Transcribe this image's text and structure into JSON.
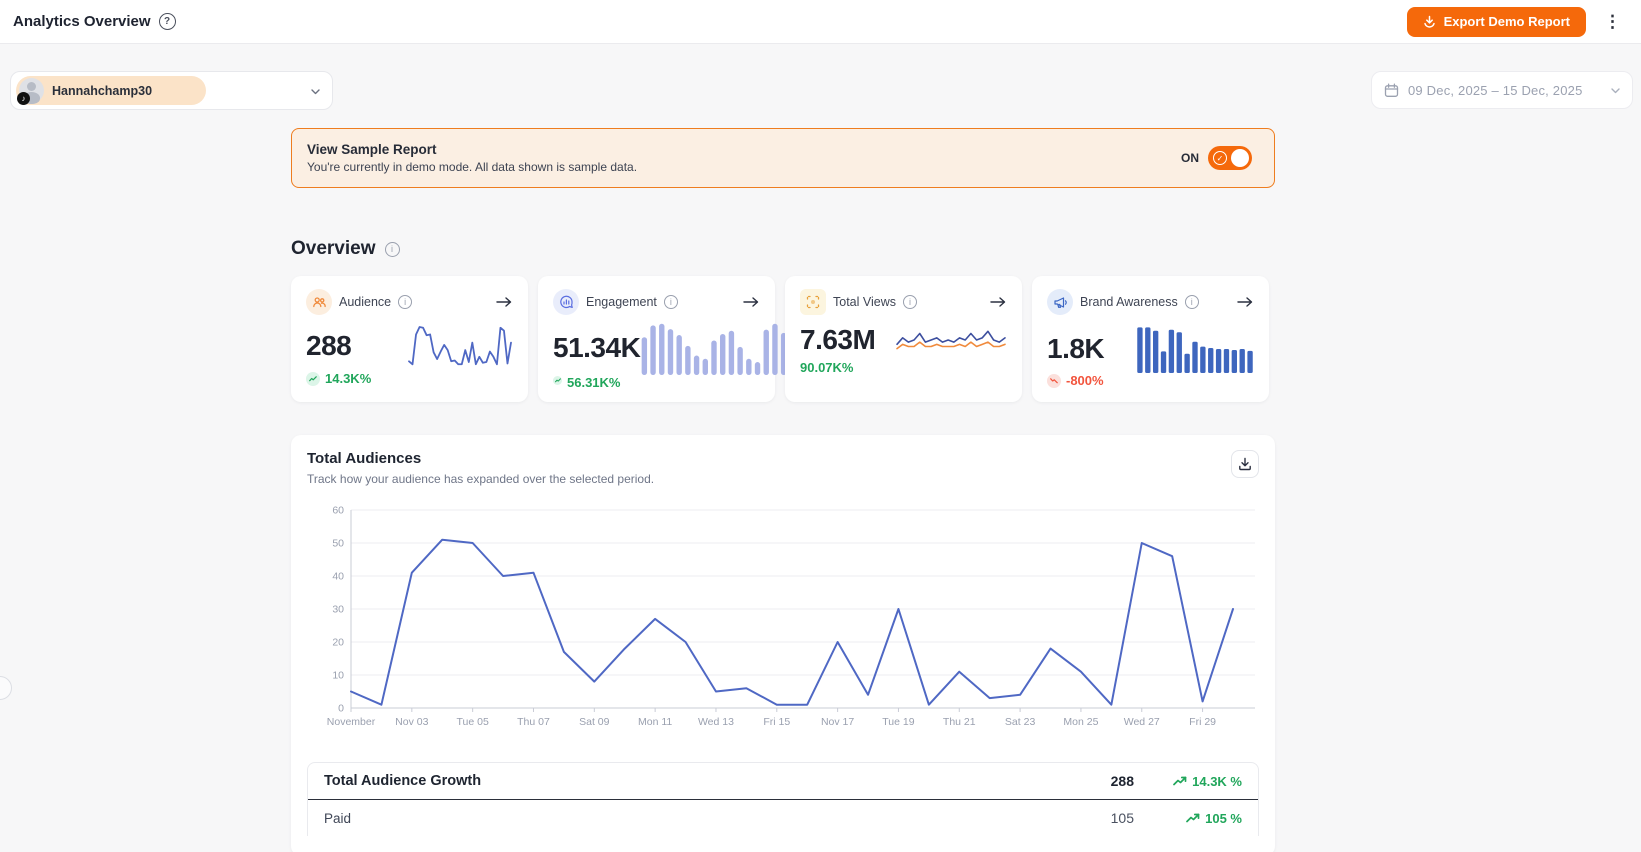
{
  "header": {
    "title": "Analytics Overview",
    "help_icon": "question-mark",
    "export_label": "Export Demo Report",
    "menu_icon": "kebab-menu"
  },
  "toolbar": {
    "account_name": "Hannahchamp30",
    "account_platform_icon": "tiktok-note",
    "date_range": "09 Dec, 2025 – 15 Dec, 2025"
  },
  "banner": {
    "title": "View Sample Report",
    "subtitle": "You're currently in demo mode. All data shown is sample data.",
    "toggle_label": "ON",
    "toggle_state": "on"
  },
  "overview": {
    "heading": "Overview",
    "cards": [
      {
        "label": "Audience",
        "value": "288",
        "change": "14.3K%",
        "trend": "up",
        "icon": "audience-people-icon",
        "accent": "#F08A3C",
        "accent_bg": "#FCEEDF",
        "spark_type": "line",
        "spark": [
          5,
          1,
          41,
          51,
          50,
          40,
          41,
          17,
          8,
          18,
          27,
          20,
          5,
          6,
          1,
          1,
          20,
          4,
          30,
          1,
          11,
          3,
          4,
          18,
          11,
          1,
          50,
          46,
          2,
          30
        ]
      },
      {
        "label": "Engagement",
        "value": "51.34K",
        "change": "56.31K%",
        "trend": "up",
        "icon": "engagement-bubble-icon",
        "accent": "#5B6EE0",
        "accent_bg": "#E9EDFB",
        "spark_type": "bars-rounded",
        "spark": [
          70,
          92,
          95,
          85,
          74,
          54,
          36,
          30,
          64,
          76,
          82,
          52,
          30,
          24,
          84,
          95,
          78
        ]
      },
      {
        "label": "Total Views",
        "value": "7.63M",
        "change": "90.07K%",
        "trend": "up-noicon",
        "icon": "views-focus-icon",
        "accent": "#E8B23A",
        "accent_bg": "#FCF5DF",
        "spark_type": "dual-line",
        "spark": [
          4,
          7,
          5,
          6,
          9,
          5,
          6,
          7,
          5,
          6,
          5,
          7,
          6,
          9,
          6,
          7,
          10,
          6,
          5,
          7
        ],
        "spark2": [
          2,
          4,
          3,
          3,
          5,
          3,
          3,
          4,
          3,
          3,
          3,
          4,
          3,
          5,
          3,
          4,
          5,
          3,
          3,
          4
        ]
      },
      {
        "label": "Brand Awareness",
        "value": "1.8K",
        "change": "-800%",
        "trend": "down",
        "icon": "megaphone-icon",
        "accent": "#3B66C4",
        "accent_bg": "#E4ECFA",
        "spark_type": "bars",
        "spark": [
          95,
          95,
          88,
          45,
          90,
          85,
          40,
          65,
          55,
          52,
          50,
          50,
          48,
          50,
          46
        ]
      }
    ]
  },
  "audience_section": {
    "title": "Total Audiences",
    "subtitle": "Track how your audience has expanded over the selected period.",
    "download_icon": "download",
    "table": {
      "rows": [
        {
          "label": "Total Audience Growth",
          "value": "288",
          "change": "14.3K %"
        },
        {
          "label": "Paid",
          "value": "105",
          "change": "105 %"
        }
      ]
    }
  },
  "chart_data": {
    "type": "line",
    "title": "Total Audiences",
    "xlabel": "",
    "ylabel": "",
    "ylim": [
      0,
      60
    ],
    "y_ticks": [
      0,
      10,
      20,
      30,
      40,
      50,
      60
    ],
    "grid": true,
    "legend": "none",
    "line_color": "#4F68C4",
    "x_tick_labels": [
      "November",
      "Nov 03",
      "Tue 05",
      "Thu 07",
      "Sat 09",
      "Mon 11",
      "Wed 13",
      "Fri 15",
      "Nov 17",
      "Tue 19",
      "Thu 21",
      "Sat 23",
      "Mon 25",
      "Wed 27",
      "Fri 29"
    ],
    "x_tick_positions": [
      0,
      2,
      4,
      6,
      8,
      10,
      12,
      14,
      16,
      18,
      20,
      22,
      24,
      26,
      28
    ],
    "values": [
      5,
      1,
      41,
      51,
      50,
      40,
      41,
      17,
      8,
      18,
      27,
      20,
      5,
      6,
      1,
      1,
      20,
      4,
      30,
      1,
      11,
      3,
      4,
      18,
      11,
      1,
      50,
      46,
      2,
      30
    ]
  },
  "colors": {
    "accent": "#F5690B",
    "green": "#21A65B",
    "red": "#F2543D",
    "chart_line": "#4F68C4"
  }
}
